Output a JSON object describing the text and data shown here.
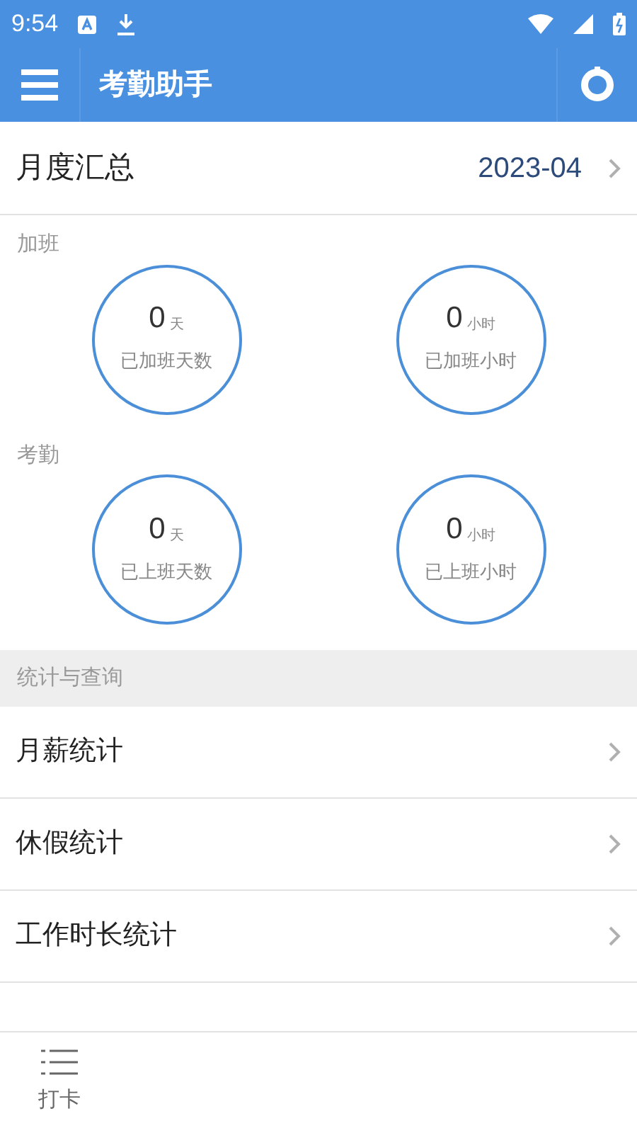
{
  "status_bar": {
    "time": "9:54"
  },
  "app_bar": {
    "title": "考勤助手"
  },
  "monthly_summary": {
    "label": "月度汇总",
    "month": "2023-04"
  },
  "stat_groups": [
    {
      "title": "加班",
      "stats": [
        {
          "value": "0",
          "unit": "天",
          "label": "已加班天数"
        },
        {
          "value": "0",
          "unit": "小时",
          "label": "已加班小时"
        }
      ]
    },
    {
      "title": "考勤",
      "stats": [
        {
          "value": "0",
          "unit": "天",
          "label": "已上班天数"
        },
        {
          "value": "0",
          "unit": "小时",
          "label": "已上班小时"
        }
      ]
    }
  ],
  "section_header": "统计与查询",
  "menu_items": [
    "月薪统计",
    "休假统计",
    "工作时长统计"
  ],
  "bottom_nav": [
    {
      "label": "打卡"
    }
  ]
}
